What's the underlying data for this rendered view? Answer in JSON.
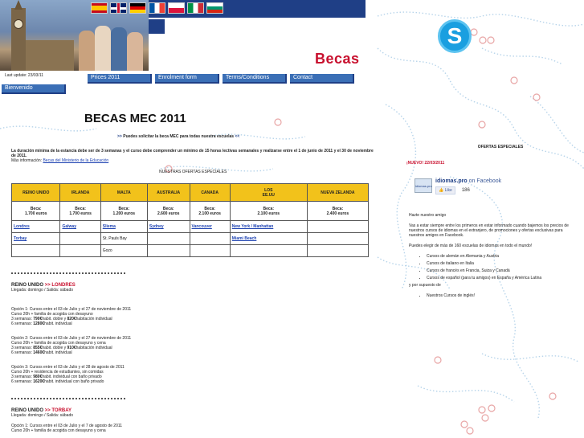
{
  "header": {
    "brand": "Becas",
    "last_update": "Last update: 23/03/11",
    "flags": [
      "es",
      "uk",
      "de",
      "fr",
      "pl",
      "it",
      "bg"
    ]
  },
  "nav": {
    "prices": "Prices 2011",
    "enrolment": "Enrolment form",
    "terms": "Terms/Conditions",
    "contact": "Contact",
    "home": "Bienvenido"
  },
  "main": {
    "title": "BECAS MEC 2011",
    "subtitle_prefix": ">> ",
    "subtitle": "Puedes solicitar la beca MEC para todas nuestra escuelas",
    "subtitle_suffix": " <<",
    "intro": "La duración mínima de la estancia debe ser de 3 semanas y el curso debe comprender un mínimo de 15 horas lectivas semanales y realizarse entre el 1 de junio de 2011 y el 30 de noviembre de 2011.",
    "more_info_label": "Más información:",
    "more_info_link": "Becas del Ministerio de la Educación",
    "offers_heading": "NUESTRAS OFERTAS ESPECIALES"
  },
  "table": {
    "headers": [
      "REINO UNIDO",
      "IRLANDA",
      "MALTA",
      "AUSTRALIA",
      "CANADA",
      "LOS\nEE.UU",
      "NUEVA ZELANDA"
    ],
    "beca_label": "Beca:",
    "prices": [
      "1.700 euros",
      "1.700 euros",
      "1.200 euros",
      "2.600 euros",
      "2.100 euros",
      "2.100 euros",
      "2.400 euros"
    ],
    "row1": [
      "Londres",
      "Galway",
      "Sliema",
      "Sydney",
      "Vancouver",
      "New York / Manhattan",
      ""
    ],
    "row2": [
      "Torbay",
      "",
      "St. Pauls Bay",
      "",
      "",
      "Miami Beach",
      ""
    ],
    "row3": [
      "",
      "",
      "Gozo",
      "",
      "",
      "",
      ""
    ]
  },
  "sections": [
    {
      "country": "REINO UNIDO",
      "sep": ">>",
      "city": "LONDRES",
      "arrival": "Llegada: domingo / Salida: sábado",
      "options": [
        {
          "line1": "Opción 1: Cursos entre el 03 de Julio y el 27 de noviembre de 2011",
          "line2": "Curso 20h + familia de acogida con desayuno",
          "line3a": "3 semanas: ",
          "line3b": "790€",
          "line3c": "habit. doble y ",
          "line3d": "820€",
          "line3e": "habitación individual",
          "line4a": "6 semanas: ",
          "line4b": "1280€",
          "line4c": "habit. individual"
        },
        {
          "line1": "Opción 2: Cursos entre el 03 de Julio y el 27 de noviembre de 2011",
          "line2": "Curso 20h + familia de acogida con desayuno y cena",
          "line3a": "3 semanas: ",
          "line3b": "855€",
          "line3c": "habit. doble y ",
          "line3d": "910€",
          "line3e": "habitación individual",
          "line4a": "6 semanas: ",
          "line4b": "1460€",
          "line4c": "habit. individual"
        },
        {
          "line1": "Opción 3: Cursos entre el 03 de Julio y el 28 de agosto de 2011",
          "line2": "Curso 20h + residencia de estudiantes, sin comidas",
          "line3a": "3 semanas: ",
          "line3b": "980€",
          "line3c": "habit. individual con baño privado",
          "line3d": "",
          "line3e": "",
          "line4a": "6 semanas: ",
          "line4b": "1620€",
          "line4c": "habit. individual con baño privado"
        }
      ]
    },
    {
      "country": "REINO UNIDO",
      "sep": ">>",
      "city": "TORBAY",
      "arrival": "Llegada: domingo / Salida: sábado",
      "options": [
        {
          "line1": "Opción 1: Cursos entre el 03 de Julio y el 7 de agosto de 2011",
          "line2": "Curso 20h + familia de acogida con desayuno y cena"
        }
      ]
    }
  ],
  "sidebar": {
    "title": "OFERTAS ESPECIALES",
    "nuevo": "¡NUEVO! 22/03/2011",
    "fb_logo": "idiomas.pro",
    "fb_name": "idiomas.pro",
    "fb_suffix": " on Facebook",
    "fb_like": "Like",
    "fb_count": "186",
    "greeting": "Hazte nuestro amigo",
    "p1": "Vas a estar siempre entre los primeros en estar informado cuando bajemos los precios de nuestros cursos de idiomas en el extranjero, de promociones y ofertas exclusivas para nuestros amigos en Facebook.",
    "p2": "Puedes elegir de más de 160 escuelas de idiomas en todo el mundo!",
    "list1": [
      "Cursos de alemán en Alemania y Austria",
      "Cursos de italiano en Italia",
      "Cursos de francés en Francia, Suiza y Canadá",
      "Cursos de español (para tu amigos) en España y América Latina"
    ],
    "p3": "y por supuesto de",
    "list2": [
      "Nuestros Cursos de inglés!"
    ]
  }
}
